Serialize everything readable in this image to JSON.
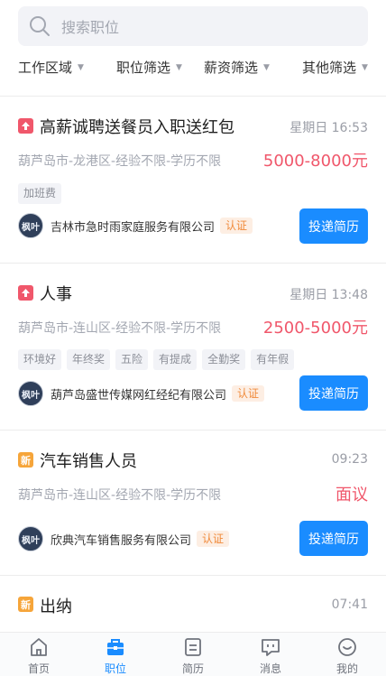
{
  "search": {
    "placeholder": "搜索职位"
  },
  "filters": [
    {
      "label": "工作区域"
    },
    {
      "label": "职位筛选"
    },
    {
      "label": "薪资筛选"
    },
    {
      "label": "其他筛选"
    }
  ],
  "jobs": [
    {
      "badge": "hot",
      "title": "高薪诚聘送餐员入职送红包",
      "time": "星期日 16:53",
      "meta": "葫芦岛市-龙港区-经验不限-学历不限",
      "salary": "5000-8000元",
      "tags": [
        "加班费"
      ],
      "avatar_text": "枫叶",
      "company": "吉林市急时雨家庭服务有限公司",
      "verified": "认证",
      "apply": "投递简历"
    },
    {
      "badge": "hot",
      "title": "人事",
      "time": "星期日 13:48",
      "meta": "葫芦岛市-连山区-经验不限-学历不限",
      "salary": "2500-5000元",
      "tags": [
        "环境好",
        "年终奖",
        "五险",
        "有提成",
        "全勤奖",
        "有年假"
      ],
      "avatar_text": "枫叶",
      "company": "葫芦岛盛世传媒网红经纪有限公司",
      "verified": "认证",
      "apply": "投递简历"
    },
    {
      "badge": "new",
      "badge_text": "新",
      "title": "汽车销售人员",
      "time": "09:23",
      "meta": "葫芦岛市-连山区-经验不限-学历不限",
      "salary": "面议",
      "tags": [],
      "avatar_text": "枫叶",
      "company": "欣典汽车销售服务有限公司",
      "verified": "认证",
      "apply": "投递简历"
    },
    {
      "badge": "new",
      "badge_text": "新",
      "title": "出纳",
      "time": "07:41"
    }
  ],
  "tabbar": [
    {
      "label": "首页",
      "icon": "home-icon"
    },
    {
      "label": "职位",
      "icon": "briefcase-icon",
      "active": true
    },
    {
      "label": "简历",
      "icon": "resume-icon"
    },
    {
      "label": "消息",
      "icon": "message-icon"
    },
    {
      "label": "我的",
      "icon": "profile-icon"
    }
  ],
  "colors": {
    "accent": "#1a8cff",
    "salary": "#f0576b",
    "hot": "#f0576b",
    "new": "#f6a53a"
  }
}
